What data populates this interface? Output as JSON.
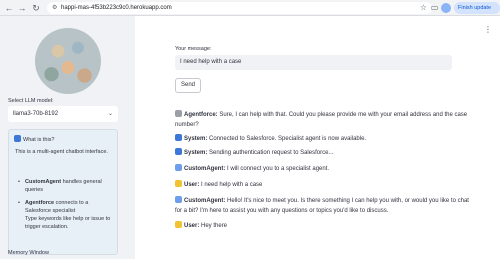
{
  "browser": {
    "url": "happi-mas-4f53b223c9c0.herokuapp.com",
    "finish_update": "Finish update"
  },
  "sidebar": {
    "llm_label": "Select LLM model:",
    "llm_selected": "llama3-70b-8192",
    "info": {
      "header": "What is this?",
      "intro": "This is a multi-agent chatbot interface.",
      "bullets": [
        {
          "name": "CustomAgent",
          "text": "handles general queries"
        },
        {
          "name": "Agentforce",
          "text": "connects to a Salesforce specialist",
          "extra": "Type keywords like help or issue to trigger escalation."
        }
      ]
    },
    "memory_label": "Memory Window"
  },
  "main": {
    "message_label": "Your message:",
    "message_value": "I need help with a case",
    "send_label": "Send",
    "chat": [
      {
        "icon": "tools-icon",
        "color": "#9aa0a6",
        "speaker": "Agentforce",
        "text": "Sure, I can help with that. Could you please provide me with your email address and the case number?"
      },
      {
        "icon": "info-icon",
        "color": "#3c78d8",
        "speaker": "System",
        "text": "Connected to Salesforce. Specialist agent is now available."
      },
      {
        "icon": "info-icon",
        "color": "#3c78d8",
        "speaker": "System",
        "text": "Sending authentication request to Salesforce..."
      },
      {
        "icon": "robot-icon",
        "color": "#6d9eeb",
        "speaker": "CustomAgent",
        "text": "I will connect you to a specialist agent."
      },
      {
        "icon": "smile-icon",
        "color": "#f1c232",
        "speaker": "User",
        "text": "I need help with a case"
      },
      {
        "icon": "robot-icon",
        "color": "#6d9eeb",
        "speaker": "CustomAgent",
        "text": "Hello! It's nice to meet you. Is there something I can help you with, or would you like to chat for a bit? I'm here to assist you with any questions or topics you'd like to discuss."
      },
      {
        "icon": "smile-icon",
        "color": "#f1c232",
        "speaker": "User",
        "text": "Hey there"
      }
    ]
  }
}
